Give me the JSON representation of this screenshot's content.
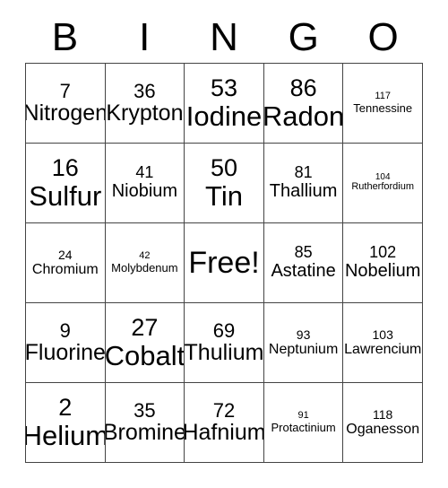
{
  "card": {
    "title_letters": [
      "B",
      "I",
      "N",
      "G",
      "O"
    ],
    "free_space_label": "Free!",
    "rows": [
      [
        {
          "number": "7",
          "label": "Nitrogen",
          "size": "lg"
        },
        {
          "number": "36",
          "label": "Krypton",
          "size": "lg"
        },
        {
          "number": "53",
          "label": "Iodine",
          "size": "xl"
        },
        {
          "number": "86",
          "label": "Radon",
          "size": "xl"
        },
        {
          "number": "117",
          "label": "Tennessine",
          "size": "xs"
        }
      ],
      [
        {
          "number": "16",
          "label": "Sulfur",
          "size": "xl"
        },
        {
          "number": "41",
          "label": "Niobium",
          "size": "md"
        },
        {
          "number": "50",
          "label": "Tin",
          "size": "xl"
        },
        {
          "number": "81",
          "label": "Thallium",
          "size": "md"
        },
        {
          "number": "104",
          "label": "Rutherfordium",
          "size": "xxs"
        }
      ],
      [
        {
          "number": "24",
          "label": "Chromium",
          "size": "sm"
        },
        {
          "number": "42",
          "label": "Molybdenum",
          "size": "xs"
        },
        {
          "number": "",
          "label": "Free!",
          "size": "free"
        },
        {
          "number": "85",
          "label": "Astatine",
          "size": "md"
        },
        {
          "number": "102",
          "label": "Nobelium",
          "size": "md"
        }
      ],
      [
        {
          "number": "9",
          "label": "Fluorine",
          "size": "lg"
        },
        {
          "number": "27",
          "label": "Cobalt",
          "size": "xl"
        },
        {
          "number": "69",
          "label": "Thulium",
          "size": "lg"
        },
        {
          "number": "93",
          "label": "Neptunium",
          "size": "sm"
        },
        {
          "number": "103",
          "label": "Lawrencium",
          "size": "sm"
        }
      ],
      [
        {
          "number": "2",
          "label": "Helium",
          "size": "xl"
        },
        {
          "number": "35",
          "label": "Bromine",
          "size": "lg"
        },
        {
          "number": "72",
          "label": "Hafnium",
          "size": "lg"
        },
        {
          "number": "91",
          "label": "Protactinium",
          "size": "xs"
        },
        {
          "number": "118",
          "label": "Oganesson",
          "size": "sm"
        }
      ]
    ]
  },
  "colors": {
    "border": "#444444",
    "text": "#000000",
    "background": "#ffffff"
  }
}
